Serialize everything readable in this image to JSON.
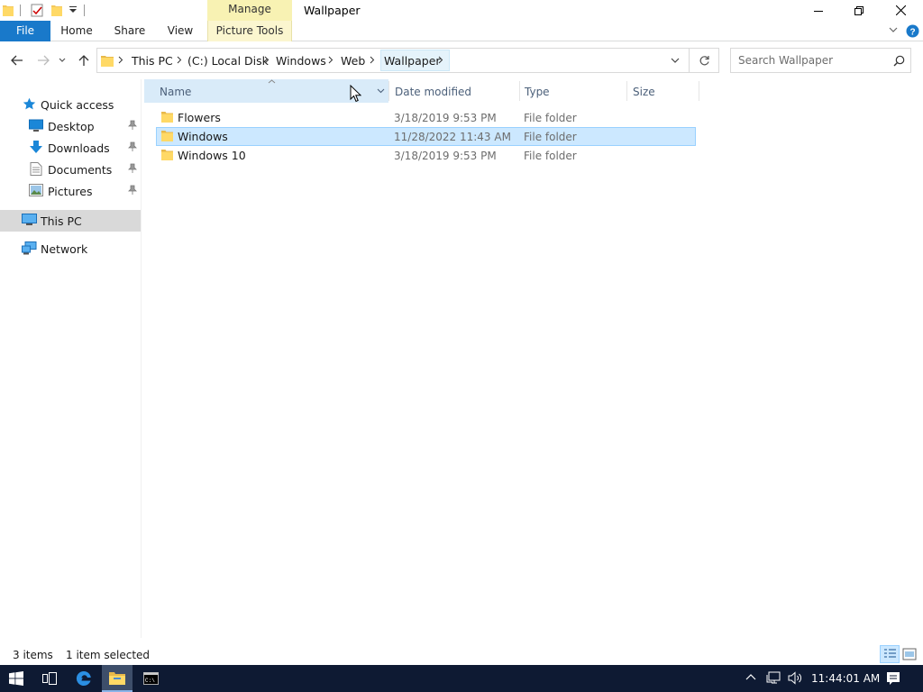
{
  "window": {
    "title": "Wallpaper",
    "context_group": "Manage"
  },
  "ribbon": {
    "tabs": [
      "File",
      "Home",
      "Share",
      "View",
      "Picture Tools"
    ]
  },
  "address": {
    "crumbs": [
      "This PC",
      "(C:) Local Disk",
      "Windows",
      "Web",
      "Wallpaper"
    ]
  },
  "search": {
    "placeholder": "Search Wallpaper"
  },
  "nav": {
    "quick_access": "Quick access",
    "items": [
      {
        "label": "Desktop",
        "icon": "desktop-icon"
      },
      {
        "label": "Downloads",
        "icon": "downloads-icon"
      },
      {
        "label": "Documents",
        "icon": "documents-icon"
      },
      {
        "label": "Pictures",
        "icon": "pictures-icon"
      }
    ],
    "this_pc": "This PC",
    "network": "Network"
  },
  "columns": {
    "name": "Name",
    "date": "Date modified",
    "type": "Type",
    "size": "Size"
  },
  "files": [
    {
      "name": "Flowers",
      "date": "3/18/2019 9:53 PM",
      "type": "File folder",
      "selected": false
    },
    {
      "name": "Windows",
      "date": "11/28/2022 11:43 AM",
      "type": "File folder",
      "selected": true
    },
    {
      "name": "Windows 10",
      "date": "3/18/2019 9:53 PM",
      "type": "File folder",
      "selected": false
    }
  ],
  "status": {
    "count": "3 items",
    "selection": "1 item selected"
  },
  "taskbar": {
    "clock": "11:44:01 AM"
  },
  "colors": {
    "accent": "#1979ca",
    "selection": "#cce8ff",
    "manage_tab": "#f7f0a6",
    "taskbar": "#0e1a33"
  }
}
